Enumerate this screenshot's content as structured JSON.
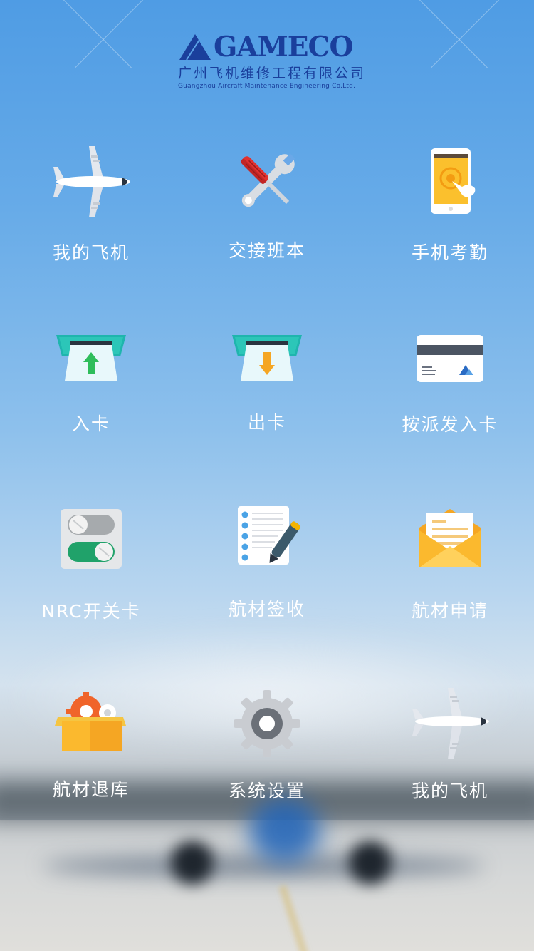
{
  "logo": {
    "brand": "GAMECO",
    "chinese_name": "广州飞机维修工程有限公司",
    "english_name": "Guangzhou Aircraft Maintenance Engineering Co.Ltd.",
    "color": "#1a3f9c"
  },
  "menu": [
    {
      "label": "我的飞机",
      "icon": "airplane-icon"
    },
    {
      "label": "交接班本",
      "icon": "tools-icon"
    },
    {
      "label": "手机考勤",
      "icon": "phone-touch-icon"
    },
    {
      "label": "入卡",
      "icon": "card-in-icon"
    },
    {
      "label": "出卡",
      "icon": "card-out-icon"
    },
    {
      "label": "按派发入卡",
      "icon": "id-card-icon"
    },
    {
      "label": "NRC开关卡",
      "icon": "toggle-switch-icon"
    },
    {
      "label": "航材签收",
      "icon": "checklist-pen-icon"
    },
    {
      "label": "航材申请",
      "icon": "envelope-icon"
    },
    {
      "label": "航材退库",
      "icon": "box-gears-icon"
    },
    {
      "label": "系统设置",
      "icon": "gear-icon"
    },
    {
      "label": "我的飞机",
      "icon": "airplane-icon"
    }
  ]
}
